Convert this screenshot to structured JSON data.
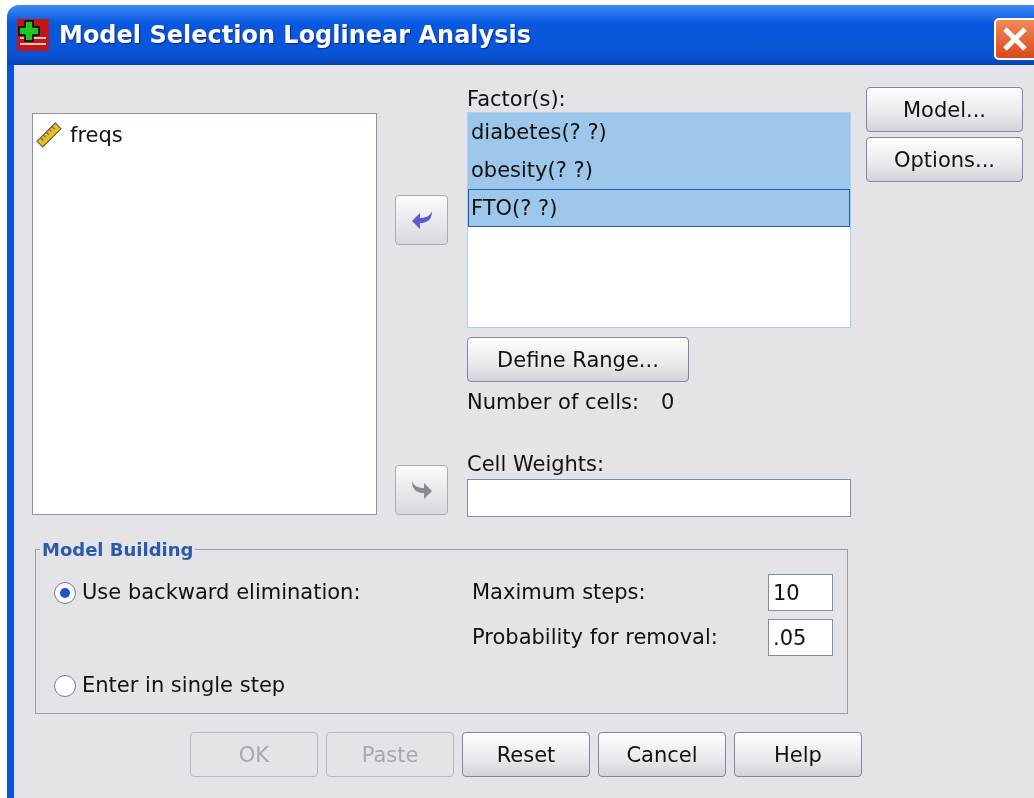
{
  "window": {
    "title": "Model Selection Loglinear Analysis"
  },
  "variables": [
    {
      "name": "freqs",
      "selected": false
    }
  ],
  "move_buttons": [
    {
      "kind": "left",
      "disabled": false
    },
    {
      "kind": "right",
      "disabled": true
    }
  ],
  "factors": {
    "label": "Factor(s):",
    "items": [
      {
        "label": "diabetes(? ?)",
        "selected": true,
        "focused": false
      },
      {
        "label": "obesity(? ?)",
        "selected": true,
        "focused": false
      },
      {
        "label": "FTO(? ?)",
        "selected": true,
        "focused": true
      }
    ]
  },
  "define_range_button": "Define Range...",
  "number_of_cells": {
    "label": "Number of cells:",
    "value": "0"
  },
  "cell_weights": {
    "label": "Cell Weights:"
  },
  "side_buttons": [
    "Model...",
    "Options..."
  ],
  "model_building": {
    "title": "Model Building",
    "options": [
      {
        "label": "Use backward elimination:",
        "selected": true
      },
      {
        "label": "Enter in single step",
        "selected": false
      }
    ],
    "fields": [
      {
        "label": "Maximum steps:",
        "value": "10"
      },
      {
        "label": "Probability for removal:",
        "value": ".05"
      }
    ]
  },
  "buttons": [
    {
      "label": "OK",
      "disabled": true
    },
    {
      "label": "Paste",
      "disabled": true
    },
    {
      "label": "Reset",
      "disabled": false
    },
    {
      "label": "Cancel",
      "disabled": false
    },
    {
      "label": "Help",
      "disabled": false
    }
  ]
}
